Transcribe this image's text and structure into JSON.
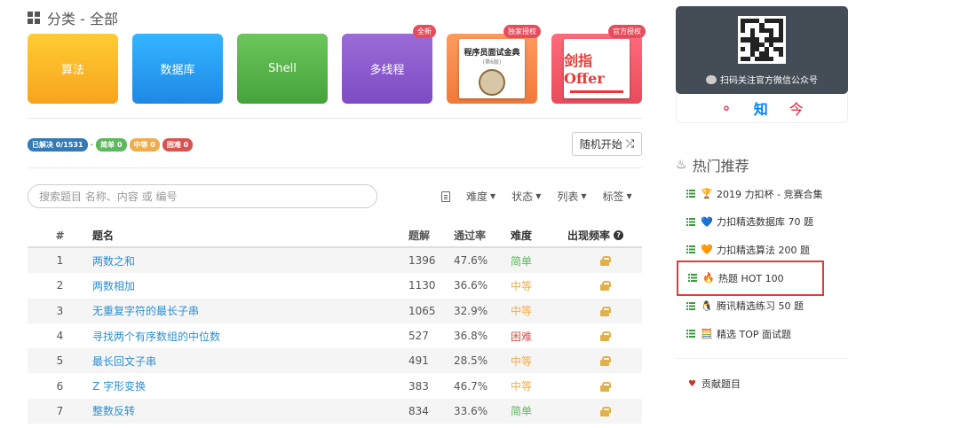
{
  "category": {
    "title": "分类 - 全部"
  },
  "tiles": [
    {
      "label": "算法",
      "color": "#f7a41d"
    },
    {
      "label": "数据库",
      "color": "#1e88e5"
    },
    {
      "label": "Shell",
      "color": "#45a33b"
    },
    {
      "label": "多线程",
      "color": "#7d4bc3",
      "ribbon": "全新"
    },
    {
      "book_title": "程序员面试金典",
      "book_sub": "(第6版)",
      "ribbon": "独家授权"
    },
    {
      "book_title": "剑指Offer",
      "ribbon": "官方授权"
    }
  ],
  "stats": {
    "solved": "已解决 0/1531",
    "separator": "-",
    "easy": "简单 0",
    "medium": "中等 0",
    "hard": "困难 0"
  },
  "random_button": {
    "label": "随机开始",
    "icon": "shuffle-icon"
  },
  "search": {
    "placeholder": "搜索题目 名称、内容 或 编号"
  },
  "filters": [
    "难度",
    "状态",
    "列表",
    "标签"
  ],
  "table": {
    "headers": {
      "num": "#",
      "title": "题名",
      "solutions": "题解",
      "rate": "通过率",
      "difficulty": "难度",
      "frequency": "出现频率"
    },
    "rows": [
      {
        "num": "1",
        "title": "两数之和",
        "solutions": "1396",
        "rate": "47.6%",
        "difficulty": "简单",
        "level": "easy"
      },
      {
        "num": "2",
        "title": "两数相加",
        "solutions": "1130",
        "rate": "36.6%",
        "difficulty": "中等",
        "level": "medium"
      },
      {
        "num": "3",
        "title": "无重复字符的最长子串",
        "solutions": "1065",
        "rate": "32.9%",
        "difficulty": "中等",
        "level": "medium"
      },
      {
        "num": "4",
        "title": "寻找两个有序数组的中位数",
        "solutions": "527",
        "rate": "36.8%",
        "difficulty": "困难",
        "level": "hard"
      },
      {
        "num": "5",
        "title": "最长回文子串",
        "solutions": "491",
        "rate": "28.5%",
        "difficulty": "中等",
        "level": "medium"
      },
      {
        "num": "6",
        "title": "Z 字形变换",
        "solutions": "383",
        "rate": "46.7%",
        "difficulty": "中等",
        "level": "medium"
      },
      {
        "num": "7",
        "title": "整数反转",
        "solutions": "834",
        "rate": "33.6%",
        "difficulty": "简单",
        "level": "easy"
      }
    ]
  },
  "sidebar": {
    "wechat_text": "扫码关注官方微信公众号",
    "social": {
      "weibo": "微",
      "zhihu": "知",
      "douban": "今"
    },
    "hot_title": "热门推荐",
    "hot_items": [
      {
        "emoji": "🏆",
        "label": "2019 力扣杯 - 竞赛合集"
      },
      {
        "emoji": "💙",
        "label": "力扣精选数据库 70 题"
      },
      {
        "emoji": "🧡",
        "label": "力扣精选算法 200 题"
      },
      {
        "emoji": "🔥",
        "label": "热题 HOT 100",
        "highlight": true
      },
      {
        "emoji": "🐧",
        "label": "腾讯精选练习 50 题"
      },
      {
        "emoji": "🧮",
        "label": "精选 TOP 面试题"
      }
    ],
    "contribute": "贡献题目"
  },
  "colors": {
    "link": "#2a8fd3",
    "easy": "#5cb85c",
    "medium": "#f0ad4e",
    "hard": "#d9534f",
    "highlight": "#e53935"
  }
}
